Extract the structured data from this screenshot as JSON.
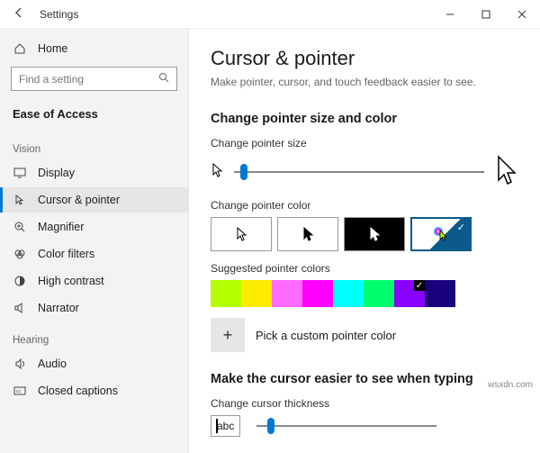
{
  "titlebar": {
    "app_title": "Settings"
  },
  "sidebar": {
    "home_label": "Home",
    "search_placeholder": "Find a setting",
    "category_label": "Ease of Access",
    "sections": {
      "vision": "Vision",
      "hearing": "Hearing"
    },
    "items": {
      "display": "Display",
      "cursor_pointer": "Cursor & pointer",
      "magnifier": "Magnifier",
      "color_filters": "Color filters",
      "high_contrast": "High contrast",
      "narrator": "Narrator",
      "audio": "Audio",
      "closed_captions": "Closed captions"
    }
  },
  "main": {
    "title": "Cursor & pointer",
    "subtitle": "Make pointer, cursor, and touch feedback easier to see.",
    "section_size_color": "Change pointer size and color",
    "label_pointer_size": "Change pointer size",
    "label_pointer_color": "Change pointer color",
    "label_suggested_colors": "Suggested pointer colors",
    "custom_color_label": "Pick a custom pointer color",
    "section_cursor": "Make the cursor easier to see when typing",
    "label_cursor_thickness": "Change cursor thickness",
    "abc_preview": "abc",
    "pointer_size_value": 1,
    "cursor_thickness_value": 1,
    "suggested_colors": [
      "#b4ff00",
      "#ffeb00",
      "#ff6aff",
      "#ff00ff",
      "#00ffff",
      "#00ff6e",
      "#8a00ff",
      "#1a007a"
    ],
    "selected_suggested_index": 6
  },
  "watermark": "wsxdn.com"
}
